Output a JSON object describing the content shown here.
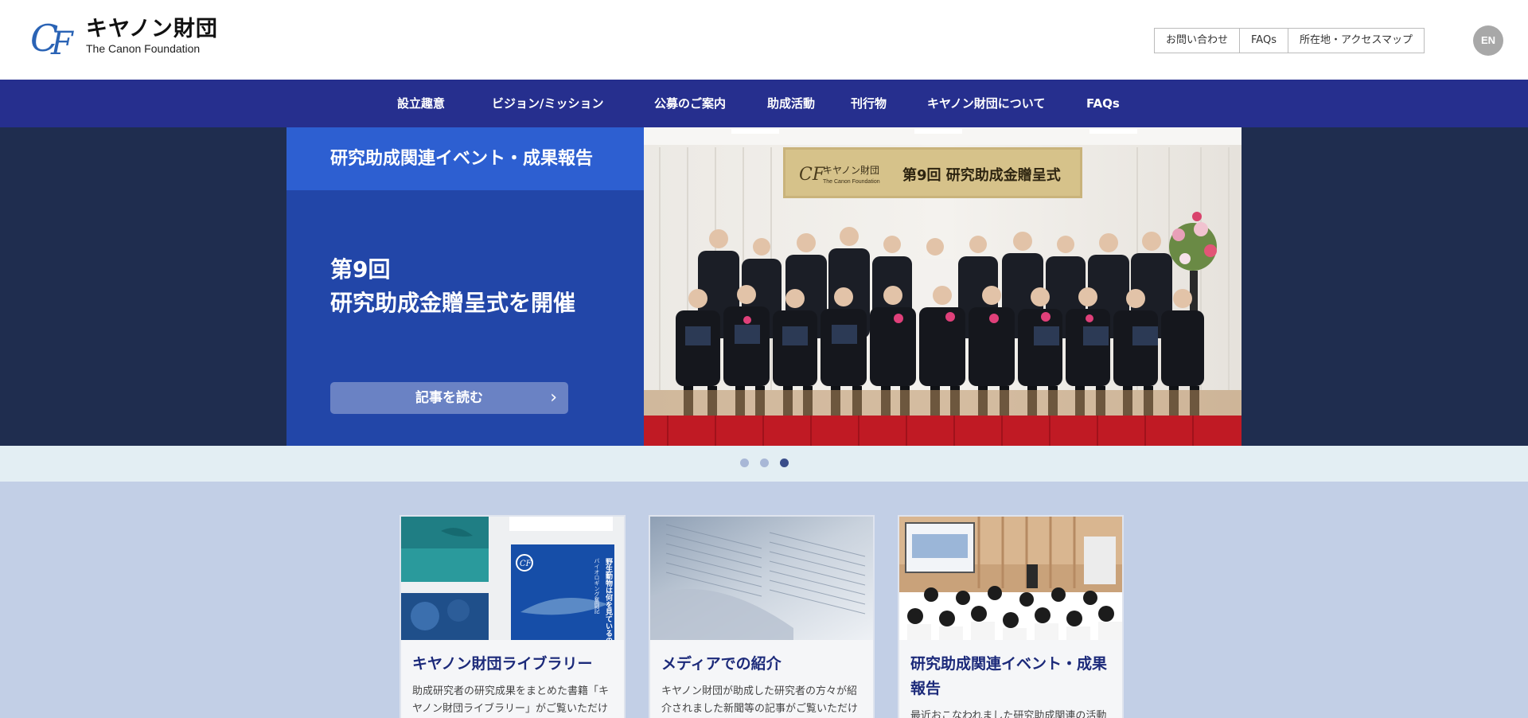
{
  "header": {
    "logo_mark": "CF",
    "logo_jp": "キヤノン財団",
    "logo_en": "The Canon Foundation",
    "util_links": [
      "お問い合わせ",
      "FAQs",
      "所在地・アクセスマップ"
    ],
    "lang_label": "EN"
  },
  "nav": {
    "items": [
      "設立趣意",
      "ビジョン/ミッション",
      "公募のご案内",
      "助成活動",
      "刊行物",
      "キヤノン財団について",
      "FAQs"
    ]
  },
  "hero": {
    "tag": "研究助成関連イベント・成果報告",
    "title_line1": "第9回",
    "title_line2": "研究助成金贈呈式を開催",
    "button_label": "記事を読む",
    "photo_banner_logo": "キヤノン財団",
    "photo_banner_logo_en": "The Canon Foundation",
    "photo_banner_text": "第9回 研究助成金贈呈式"
  },
  "slider": {
    "count": 3,
    "active_index": 2
  },
  "cards": [
    {
      "title": "キヤノン財団ライブラリー",
      "text": "助成研究者の研究成果をまとめた書籍「キヤノン財団ライブラリー」がご覧いただけ",
      "book_title": "野生動物は何を見ているのか",
      "book_sub": "バイオロギング奮闘記"
    },
    {
      "title": "メディアでの紹介",
      "text": "キヤノン財団が助成した研究者の方々が紹介されました新聞等の記事がご覧いただけ"
    },
    {
      "title": "研究助成関連イベント・成果報告",
      "text": "最近おこなわれました研究助成関連の活動"
    }
  ],
  "colors": {
    "nav_bg": "#262f8e",
    "hero_bg": "#1f2d4f",
    "hero_panel": "#2246a8",
    "hero_tag": "#2d5fd1",
    "cards_bg": "#c2cfe6",
    "card_title": "#1c2a7a"
  }
}
